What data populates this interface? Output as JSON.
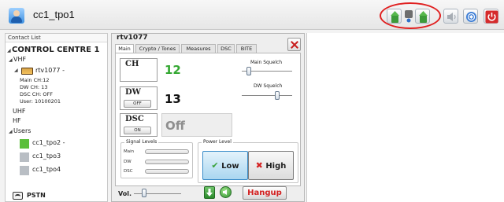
{
  "window": {
    "user_title": "cc1_tpo1"
  },
  "toolbar": {
    "buttons": [
      {
        "icon": "ptt-transmit-icon"
      },
      {
        "icon": "ptt-receive-icon"
      },
      {
        "icon": "speaker-icon"
      },
      {
        "icon": "network-icon"
      },
      {
        "icon": "power-icon"
      }
    ],
    "callout_color": "#e02020"
  },
  "contacts": {
    "header": "Contact List",
    "control_centre": "CONTROL CENTRE 1",
    "vhf": "VHF",
    "radio": {
      "name": "rtv1077 -",
      "details": [
        "Main CH:12",
        "DW CH: 13",
        "DSC CH: OFF",
        "User: 10100201"
      ]
    },
    "uhf": "UHF",
    "hf": "HF",
    "users": "Users",
    "user_list": [
      "cc1_tpo2 -",
      "cc1_tpo3",
      "cc1_tpo4"
    ],
    "pstn": "PSTN"
  },
  "radio_panel": {
    "title": "rtv1077",
    "tabs": [
      "Main",
      "Crypto / Tones",
      "Measures",
      "DSC",
      "BITE"
    ],
    "active_tab": "Main",
    "ch": {
      "label": "CH",
      "value": "12",
      "color": "#34a832"
    },
    "dw": {
      "label": "DW",
      "button": "OFF",
      "value": "13"
    },
    "dsc": {
      "label": "DSC",
      "button": "ON",
      "value": "Off"
    },
    "main_squelch": "Main Squelch",
    "dw_squelch": "DW Squelch",
    "signal_levels": {
      "title": "Signal Levels",
      "rows": [
        "Main",
        "DW",
        "DSC"
      ]
    },
    "power_level": {
      "title": "Power Level",
      "low": "Low",
      "high": "High",
      "selected": "Low"
    },
    "volume_label": "Vol.",
    "hangup": "Hangup"
  }
}
